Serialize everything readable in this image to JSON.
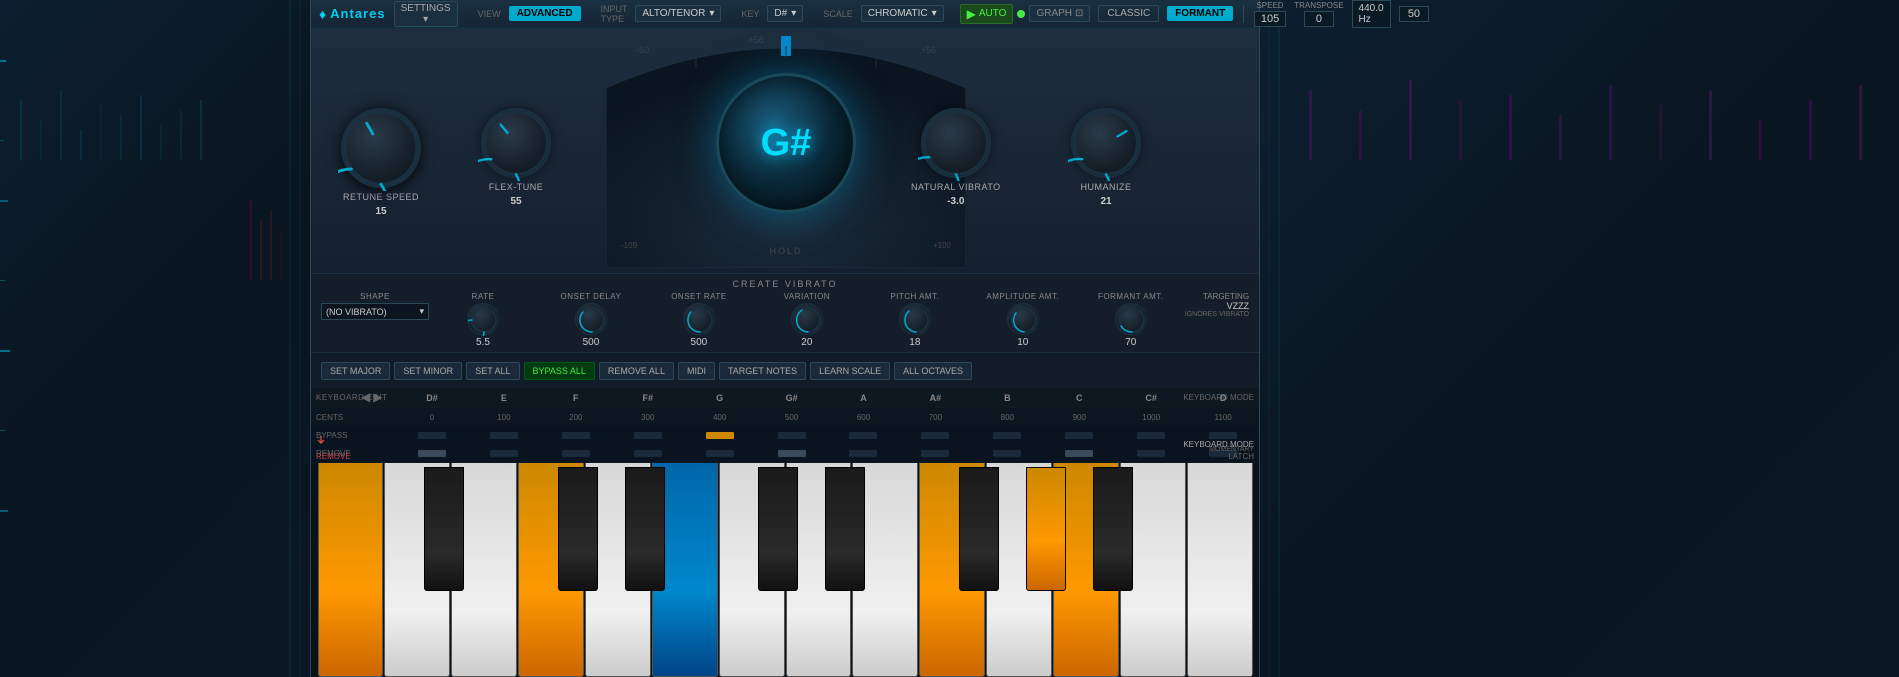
{
  "app": {
    "logo": "Antares",
    "logo_symbol": "♦",
    "settings_label": "SETTINGS ▾"
  },
  "topbar": {
    "view_label": "VIEW",
    "input_type_label": "INPUT TYPE",
    "key_label": "KEY",
    "scale_label": "SCALE",
    "advanced_btn": "ADVANCED",
    "voice_type": "ALTO/TENOR",
    "key_select": "D#",
    "scale_select": "CHROMATIC",
    "auto_btn": "AUTO",
    "graph_btn": "GRAPH",
    "classic_btn": "CLASSIC",
    "formant_btn": "FORMANT",
    "speed_label": "SPEED",
    "speed_value": "105",
    "transpose_label": "TRANSPOSE",
    "transpose_value": "0",
    "pitch_label": "440.0 Hz",
    "pitch_value": "440.0 Hz",
    "limit_value": "50"
  },
  "knobs": {
    "retune_speed": {
      "label": "RETUNE SPEED",
      "value": "15"
    },
    "flex_tune": {
      "label": "FLEX-TUNE",
      "value": "55"
    },
    "pitch_note": "G#",
    "hold_label": "HOLD",
    "natural_vibrato": {
      "label": "NATURAL VIBRATO",
      "value": "-3.0"
    },
    "humanize": {
      "label": "HUMANIZE",
      "value": "21"
    }
  },
  "vibrato": {
    "section_label": "CREATE VIBRATO",
    "shape": {
      "label": "SHAPE",
      "value": "(NO VIBRATO)"
    },
    "rate": {
      "label": "RATE",
      "value": "5.5"
    },
    "onset_delay": {
      "label": "ONSET DELAY",
      "value": "500"
    },
    "onset_rate": {
      "label": "ONSET RATE",
      "value": "500"
    },
    "variation": {
      "label": "VARIATION",
      "value": "20"
    },
    "pitch_amt": {
      "label": "PITCH AMT.",
      "value": "18"
    },
    "amplitude_amt": {
      "label": "AMPLITUDE AMT.",
      "value": "10"
    },
    "formant_amt": {
      "label": "FORMANT AMT.",
      "value": "70"
    }
  },
  "keyboard_buttons": {
    "set_major": "SET MAJOR",
    "set_minor": "SET MINOR",
    "set_all": "SET ALL",
    "bypass_all": "BYPASS ALL",
    "remove_all": "REMOVE ALL",
    "midi": "MIDI",
    "target_notes": "TARGET NOTES",
    "learn_scale": "LEARN SCALE",
    "all_octaves": "ALL OCTAVES",
    "targeting_label": "TARGETING",
    "targeting_value": "VZZZ",
    "ignores_label": "IGNORES VIBRATO"
  },
  "note_row": {
    "labels": [
      "D#",
      "E",
      "F",
      "F#",
      "G",
      "G#",
      "A",
      "A#",
      "B",
      "C",
      "C#",
      "D"
    ],
    "cents": [
      "0",
      "100",
      "200",
      "300",
      "400",
      "500",
      "600",
      "700",
      "800",
      "900",
      "1000",
      "1100"
    ],
    "cents_label": "CENTS",
    "bypass_label": "BYPASS",
    "remove_label": "REMOVE",
    "keyboard_edit_label": "KEYBOARD EDIT",
    "remove_action": "REMOVE",
    "bypass_action": "BYPASS",
    "keyboard_mode_label": "KEYBOARD MODE",
    "latch_label": "LATCH",
    "momentary_label": "MOMENTARY",
    "bypass_active_index": 4,
    "remove_gray_indices": [
      0,
      5,
      9
    ]
  },
  "piano": {
    "active_orange_white": [
      0,
      3,
      8,
      11
    ],
    "active_blue_white": [
      5
    ],
    "active_orange_black": [
      1,
      7
    ]
  },
  "colors": {
    "accent_blue": "#00aacc",
    "accent_green": "#44ee44",
    "accent_orange": "#ff9900",
    "active_btn": "#00aacc",
    "bg_dark": "#0a1520",
    "bg_medium": "#12202e",
    "text_primary": "#cccccc",
    "text_secondary": "#888888"
  }
}
